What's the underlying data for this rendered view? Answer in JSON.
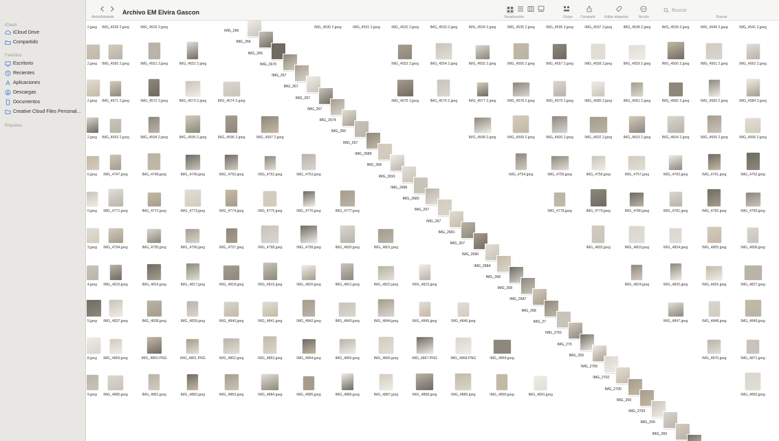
{
  "window": {
    "title": "Archivo EM Elvira Gascon",
    "nav_label": "Atrás/Adelante"
  },
  "sidebar": {
    "sections": [
      {
        "title": "iCloud",
        "items": [
          {
            "label": "iCloud Drive",
            "icon": "cloud-icon"
          },
          {
            "label": "Compartido",
            "icon": "shared-folder-icon"
          }
        ]
      },
      {
        "title": "Favoritos",
        "items": [
          {
            "label": "Escritorio",
            "icon": "desktop-icon"
          },
          {
            "label": "Recientes",
            "icon": "clock-icon"
          },
          {
            "label": "Aplicaciones",
            "icon": "apps-icon"
          },
          {
            "label": "Descargas",
            "icon": "download-icon"
          },
          {
            "label": "Documentos",
            "icon": "document-icon"
          },
          {
            "label": "Creative Cloud Files Personal...",
            "icon": "folder-icon"
          }
        ]
      },
      {
        "title": "Etiquetas",
        "items": []
      }
    ]
  },
  "toolbar": {
    "view_label": "Visualización",
    "group_label": "Grupo",
    "share_label": "Compartir",
    "tags_label": "Editar etiquetas",
    "action_label": "Acción",
    "search_label": "Buscar",
    "search_placeholder": "Buscar"
  },
  "grid": {
    "rows": [
      {
        "right": [
          "IMG_4530 2.jpeg",
          "IMG_4531 2.jpeg",
          "IMG_4532 2.jpeg",
          "IMG_4533 2.jpeg",
          "IMG_4534 2.jpeg",
          "IMG_4535 2.jpeg",
          "IMG_4536 2.jpeg",
          "IMG_4537 2.jpeg",
          "IMG_4538 2.jpeg",
          "IMG_4539 2.jpeg",
          "IMG_4540 2.jpeg",
          "IMG_4541 2.jpeg"
        ],
        "left": [
          "2.jpeg",
          "IMG_4528 2.jpeg",
          "IMG_4529 2.jpeg"
        ]
      },
      {
        "left": [
          "2.jpeg",
          "IMG_4550 2.jpeg",
          "IMG_4551 2.jpeg",
          "IMG_4552 2.jpeg"
        ],
        "right": [
          "IMG_4553 2.jpeg",
          "IMG_4554 2.jpeg",
          "IMG_4555 2.jpeg",
          "IMG_4556 2.jpeg",
          "IMG_4557 2.jpeg",
          "IMG_4558 2.jpeg",
          "IMG_4559 2.jpeg",
          "IMG_4560 2.jpeg",
          "IMG_4561 2.jpeg",
          "IMG_4562 2.jpeg"
        ]
      },
      {
        "left": [
          "2.jpeg",
          "IMG_4571 2.jpeg",
          "IMG_4572 2.jpeg",
          "IMG_4573 2.jpeg",
          "IMG_4574 2.jpeg"
        ],
        "right": [
          "IMG_4575 2.jpeg",
          "IMG_4576 2.jpeg",
          "IMG_4577 2.jpeg",
          "IMG_4578 2.jpeg",
          "IMG_4579 2.jpeg",
          "IMG_4580 2.jpeg",
          "IMG_4581 2.jpeg",
          "IMG_4582 2.jpeg",
          "IMG_4583 2.jpeg",
          "IMG_4584 2.jpeg"
        ]
      },
      {
        "left": [
          "2.jpeg",
          "IMG_4593 2.jpeg",
          "IMG_4594 2.jpeg",
          "IMG_4595 2.jpeg",
          "IMG_4596 2.jpeg",
          "IMG_4597 2.jpeg"
        ],
        "right": [
          "IMG_4598 2.jpeg",
          "IMG_4599 2.jpeg",
          "IMG_4600 2.jpeg",
          "IMG_4602 2.jpeg",
          "IMG_4603 2.jpeg",
          "IMG_4604 2.jpeg",
          "IMG_4605 2.jpeg",
          "IMG_4606 2.jpeg"
        ]
      },
      {
        "left": [
          "6.jpeg",
          "IMG_4747.jpeg",
          "IMG_4748.jpeg",
          "IMG_4749.jpeg",
          "IMG_4750.jpeg",
          "IMG_4752.jpeg",
          "IMG_4753.jpeg"
        ],
        "right": [
          "IMG_4754.jpeg",
          "IMG_4755.jpeg",
          "IMG_4756.jpeg",
          "IMG_4757.jpeg",
          "IMG_4760.jpeg",
          "IMG_4761.jpeg",
          "IMG_4762.jpeg"
        ]
      },
      {
        "left": [
          "0.jpeg",
          "IMG_4771.jpeg",
          "IMG_4772.jpeg",
          "IMG_4773.jpeg",
          "IMG_4774.jpeg",
          "IMG_4775.jpeg",
          "IMG_4776.jpeg",
          "IMG_4777.jpeg"
        ],
        "right": [
          "IMG_4778.jpeg",
          "IMG_4779.jpeg",
          "IMG_4780.jpeg",
          "IMG_4781.jpeg",
          "IMG_4782.jpeg",
          "IMG_4783.jpeg"
        ]
      },
      {
        "left": [
          "3.jpeg",
          "IMG_4794.jpeg",
          "IMG_4795.jpeg",
          "IMG_4796.jpeg",
          "IMG_4797.jpeg",
          "IMG_4798.jpeg",
          "IMG_4799.jpeg",
          "IMG_4800.jpeg",
          "IMG_4801.jpeg"
        ],
        "right": [
          "IMG_4802.jpeg",
          "IMG_4803.jpeg",
          "IMG_4804.jpeg",
          "IMG_4805.jpeg",
          "IMG_4806.jpeg"
        ]
      },
      {
        "left": [
          "4.jpeg",
          "IMG_4815.jpeg",
          "IMG_4816.jpeg",
          "IMG_4817.jpeg",
          "IMG_4818.jpeg",
          "IMG_4819.jpeg",
          "IMG_4820.jpeg",
          "IMG_4821.jpeg",
          "IMG_4822.jpeg",
          "IMG_4823.jpeg"
        ],
        "right": [
          "IMG_4824.jpeg",
          "IMG_4825.jpeg",
          "IMG_4826.jpeg",
          "IMG_4827.jpeg"
        ]
      },
      {
        "left": [
          "5.jpeg",
          "IMG_4837.jpeg",
          "IMG_4838.jpeg",
          "IMG_4839.jpeg",
          "IMG_4840.jpeg",
          "IMG_4841.jpeg",
          "IMG_4842.jpeg",
          "IMG_4843.jpeg",
          "IMG_4844.jpeg",
          "IMG_4845.jpeg",
          "IMG_4846.jpeg"
        ],
        "right": [
          "IMG_4847.jpeg",
          "IMG_4848.jpeg",
          "IMG_4849.jpeg"
        ]
      },
      {
        "left": [
          "8.jpeg",
          "IMG_4859.jpeg",
          "IMG_4860.PNG",
          "IMG_4861.PNG",
          "IMG_4862.jpeg",
          "IMG_4863.jpeg",
          "IMG_4864.jpeg",
          "IMG_4865.jpeg",
          "IMG_4866.jpeg",
          "IMG_4867.PNG",
          "IMG_4868.PNG",
          "IMG_4869.jpeg"
        ],
        "right": [
          "IMG_4870.jpeg",
          "IMG_4871.jpeg"
        ]
      },
      {
        "left": [
          "9.jpeg",
          "IMG_4880.jpeg",
          "IMG_4881.jpeg",
          "IMG_4882.jpeg",
          "IMG_4883.jpeg",
          "IMG_4884.jpeg",
          "IMG_4885.jpeg",
          "IMG_4886.jpeg",
          "IMG_4887.jpeg",
          "IMG_4888.jpeg",
          "IMG_4889.jpeg",
          "IMG_4890.jpeg",
          "IMG_4891.jpeg"
        ],
        "right": [
          "IMG_4892.jpeg"
        ]
      }
    ],
    "drag_stack_labels": [
      "IMG_266",
      "IMG_266",
      "IMG_266",
      "IMG_2670",
      "IMG_267",
      "IMG_267",
      "IMG_267",
      "IMG_267",
      "IMG_2674",
      "IMG_266",
      "IMG_267",
      "IMG_2689",
      "IMG_268",
      "IMG_2691",
      "IMG_2686",
      "IMG_2683",
      "IMG_267",
      "IMG_267",
      "IMG_2681",
      "IMG_267",
      "IMG_2690",
      "IMG_2684",
      "IMG_268",
      "IMG_268",
      "IMG_2687",
      "IMG_268",
      "IMG_27",
      "IMG_2701",
      "IMG_270",
      "IMG_269",
      "IMG_2705",
      "IMG_2702",
      "IMG_2700",
      "IMG_269",
      "IMG_2703",
      "IMG_269",
      "IMG_269",
      "IMG_2701"
    ]
  },
  "colors": {
    "sidebar_bg": "#e8e7e4",
    "accent": "#3d7bd6",
    "toolbar_bg": "#f6f6f5"
  }
}
